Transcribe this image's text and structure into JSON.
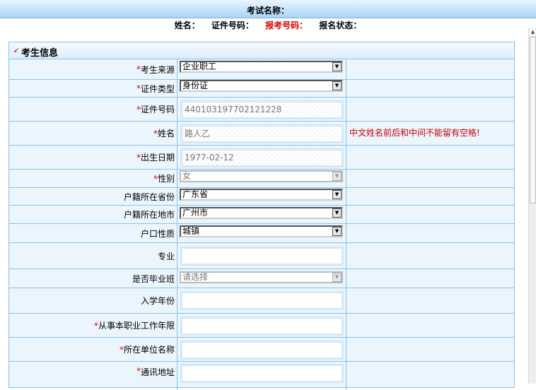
{
  "header": {
    "exam_title": "考试名称：",
    "name_label": "姓名：",
    "id_label": "证件号码：",
    "reg_no_label": "报考号码：",
    "status_label": "报名状态："
  },
  "panel": {
    "title": "考生信息"
  },
  "form": {
    "source": {
      "label": "考生来源",
      "value": "企业职工"
    },
    "id_type": {
      "label": "证件类型",
      "value": "身份证"
    },
    "id_number": {
      "label": "证件号码",
      "value": "440103197702121228"
    },
    "name": {
      "label": "姓名",
      "value": "路人乙",
      "note": "中文姓名前后和中间不能留有空格!"
    },
    "birthdate": {
      "label": "出生日期",
      "value": "1977-02-12"
    },
    "gender": {
      "label": "性别",
      "value": "女"
    },
    "province": {
      "label": "户籍所在省份",
      "value": "广东省"
    },
    "city": {
      "label": "户籍所在地市",
      "value": "广州市"
    },
    "hukou_type": {
      "label": "户口性质",
      "value": "城镇"
    },
    "major": {
      "label": "专业",
      "value": ""
    },
    "graduating_class": {
      "label": "是否毕业班",
      "value": "请选择"
    },
    "enroll_year": {
      "label": "入学年份",
      "value": ""
    },
    "work_years": {
      "label": "从事本职业工作年限",
      "value": ""
    },
    "employer": {
      "label": "所在单位名称",
      "value": ""
    },
    "address": {
      "label": "通讯地址",
      "value": ""
    }
  },
  "required_mark": "*",
  "icons": {
    "select_arrow": "dropdown-arrow-icon",
    "scroll_up": "scroll-up-icon",
    "header_marker": "red-arrow-icon"
  }
}
